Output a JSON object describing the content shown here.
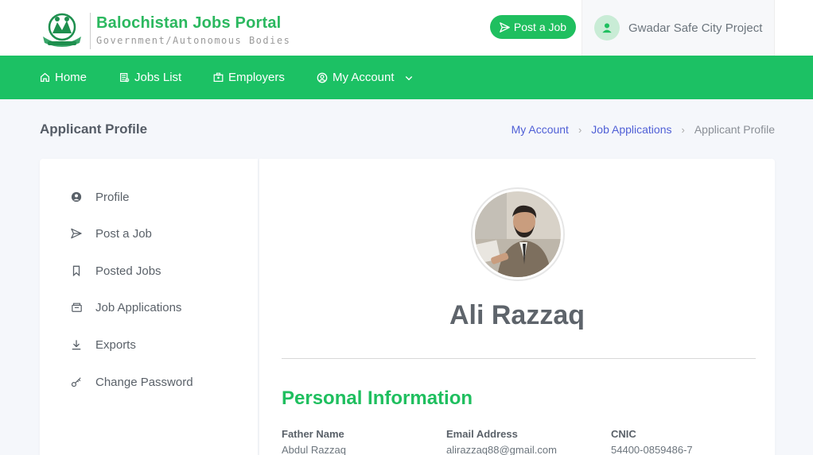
{
  "brand": {
    "title": "Balochistan Jobs Portal",
    "subtitle": "Government/Autonomous Bodies"
  },
  "header": {
    "post_job_label": "Post a Job",
    "user_name": "Gwadar Safe City Project"
  },
  "nav": {
    "items": [
      {
        "label": "Home",
        "icon": "home-icon"
      },
      {
        "label": "Jobs List",
        "icon": "jobs-list-icon"
      },
      {
        "label": "Employers",
        "icon": "employers-icon"
      },
      {
        "label": "My Account",
        "icon": "account-icon"
      }
    ]
  },
  "page": {
    "title": "Applicant Profile",
    "breadcrumb": [
      "My Account",
      "Job Applications",
      "Applicant Profile"
    ]
  },
  "sidebar": {
    "items": [
      {
        "label": "Profile",
        "icon": "user-circle-icon"
      },
      {
        "label": "Post a Job",
        "icon": "send-icon"
      },
      {
        "label": "Posted Jobs",
        "icon": "bookmark-icon"
      },
      {
        "label": "Job Applications",
        "icon": "applications-icon"
      },
      {
        "label": "Exports",
        "icon": "download-icon"
      },
      {
        "label": "Change Password",
        "icon": "key-icon"
      }
    ]
  },
  "profile": {
    "name": "Ali Razzaq",
    "section_title": "Personal Information",
    "fields": [
      {
        "label": "Father Name",
        "value": "Abdul Razzaq"
      },
      {
        "label": "Email Address",
        "value": "alirazzaq88@gmail.com"
      },
      {
        "label": "CNIC",
        "value": "54400-0859486-7"
      }
    ]
  },
  "colors": {
    "brand_green": "#1cc164",
    "link_blue": "#4f5fd6"
  }
}
